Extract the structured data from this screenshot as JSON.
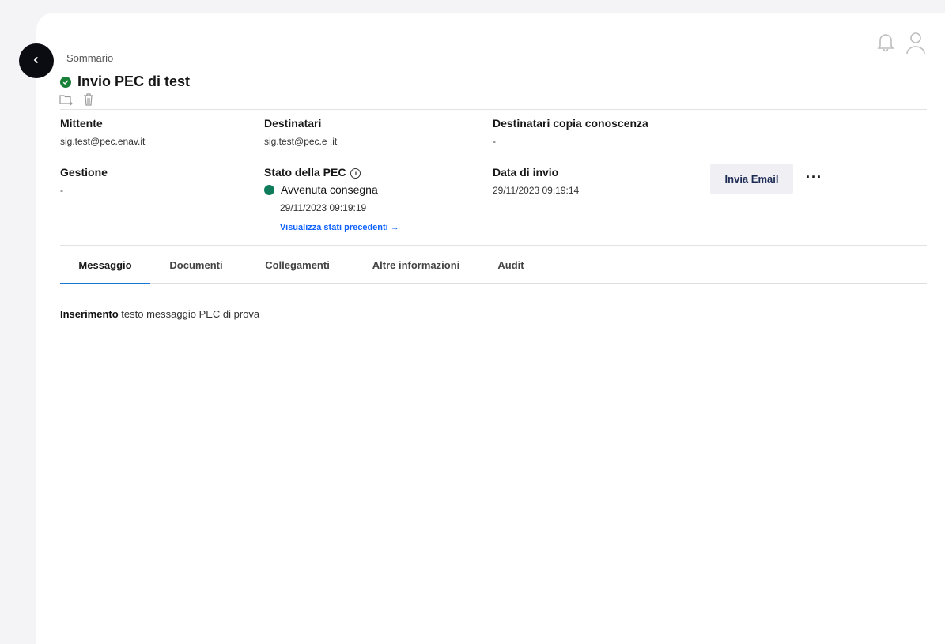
{
  "header": {
    "breadcrumb": "Sommario",
    "title": "Invio PEC di test",
    "status_color": "#198038"
  },
  "fields": {
    "sender": {
      "label": "Mittente",
      "value": "sig.test@pec.enav.it"
    },
    "recipients": {
      "label": "Destinatari",
      "value": "sig.test@pec.e          .it"
    },
    "cc": {
      "label": "Destinatari copia conoscenza",
      "value": "-"
    },
    "management": {
      "label": "Gestione",
      "value": "-"
    },
    "pec_status": {
      "label": "Stato della PEC",
      "info_icon": "i",
      "state": "Avvenuta consegna",
      "state_color": "#0e7b5b",
      "date": "29/11/2023 09:19:19",
      "link": "Visualizza stati precedenti →"
    },
    "send_date": {
      "label": "Data di invio",
      "value": "29/11/2023 09:19:14"
    }
  },
  "actions": {
    "send_email": "Invia Email",
    "more": "···"
  },
  "tabs": [
    {
      "label": "Messaggio",
      "active": true
    },
    {
      "label": "Documenti",
      "active": false
    },
    {
      "label": "Collegamenti",
      "active": false
    },
    {
      "label": "Altre informazioni",
      "active": false
    },
    {
      "label": "Audit",
      "active": false
    }
  ],
  "message": {
    "strong": "Inserimento",
    "rest": " testo messaggio PEC di prova"
  },
  "icons": [
    "bell-icon",
    "user-icon",
    "back-chevron-icon",
    "check-circle-icon",
    "folder-move-icon",
    "trash-icon",
    "info-icon"
  ]
}
